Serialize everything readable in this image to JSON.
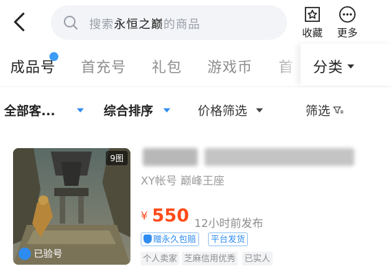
{
  "header": {
    "search": {
      "placeholder_prefix": "搜索",
      "keyword": "永恒之巅",
      "placeholder_suffix": "的商品"
    },
    "favorite_label": "收藏",
    "more_label": "更多"
  },
  "tabs": [
    {
      "label": "成品号",
      "active": true
    },
    {
      "label": "首充号",
      "active": false
    },
    {
      "label": "礼包",
      "active": false
    },
    {
      "label": "游戏币",
      "active": false
    },
    {
      "label": "首",
      "active": false
    }
  ],
  "category_label": "分类",
  "filters": {
    "client": "全部客...",
    "sort": "综合排序",
    "price": "价格筛选",
    "filter": "筛选"
  },
  "listing": {
    "image_count": "9图",
    "verified": "已验号",
    "subtitle": "XY帐号 巅峰王座",
    "currency": "¥",
    "price": "550",
    "posted": "12小时前发布",
    "tags": [
      "赠永久包赔",
      "平台发货"
    ],
    "seller_tags": [
      "个人卖家",
      "芝麻信用优秀",
      "已实人"
    ]
  },
  "colors": {
    "accent": "#2e8cf0",
    "price": "#ff4c1b",
    "badge_dot": "#3d9cf5"
  }
}
